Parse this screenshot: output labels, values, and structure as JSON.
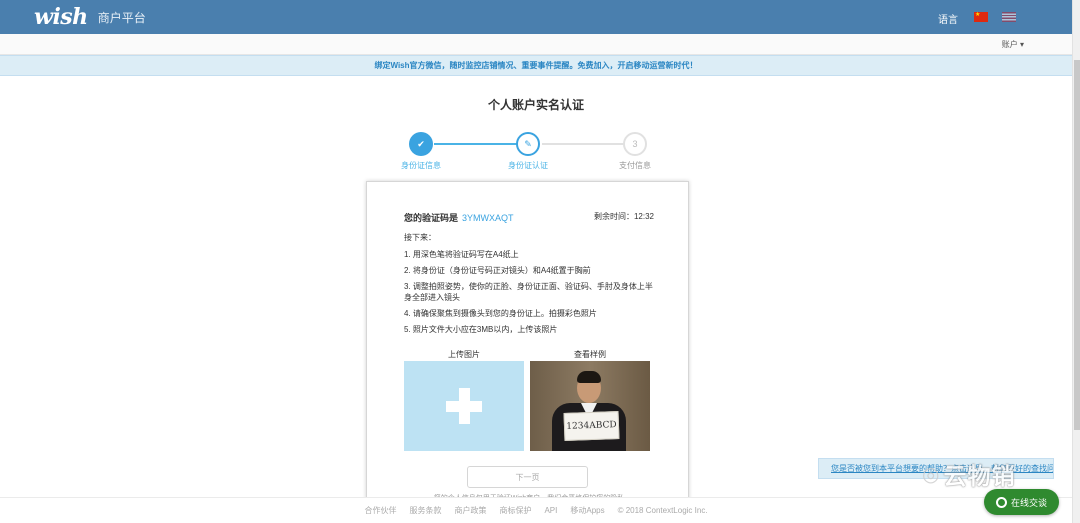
{
  "header": {
    "logo": "wish",
    "platform_title": "商户平台",
    "language_label": "语言",
    "flags": [
      "flag-cn-icon",
      "flag-us-icon"
    ],
    "brand_color": "#4a7fae"
  },
  "subbar": {
    "account_label": "账户 ▾"
  },
  "banner": {
    "text": "绑定Wish官方微信，随时监控店铺情况、重要事件提醒。免费加入，开启移动运营新时代！"
  },
  "page": {
    "title": "个人账户实名认证"
  },
  "steps": [
    {
      "icon": "✔",
      "label": "身份证信息",
      "state": "done"
    },
    {
      "icon": "✎",
      "label": "身份证认证",
      "state": "active"
    },
    {
      "icon": "3",
      "label": "支付信息",
      "state": "pending"
    }
  ],
  "verification": {
    "code_label": "您的验证码是",
    "code": "3YMWXAQT",
    "time_label": "剩余时间：",
    "time_value": "12:32",
    "next_steps_label": "接下来：",
    "instructions": [
      "1. 用深色笔将验证码写在A4纸上",
      "2. 将身份证（身份证号码正对镜头）和A4纸置于胸前",
      "3. 调整拍照姿势，使你的正脸、身份证正面、验证码、手肘及身体上半身全部进入镜头",
      "4. 请确保聚焦到摄像头到您的身份证上。拍摄彩色照片",
      "5. 照片文件大小应在3MB以内，上传该照片"
    ],
    "upload_label": "上传图片",
    "sample_label": "查看样例",
    "sample_card_text": "1234ABCD",
    "next_button": "下一页",
    "privacy_note": "您的个人信息仅用于验证Wish商户，我们会严格保护您的隐私"
  },
  "footer": {
    "links": [
      "合作伙伴",
      "服务条款",
      "商户政策",
      "商标保护",
      "API",
      "移动Apps"
    ],
    "copyright": "© 2018 ContextLogic Inc."
  },
  "help_bar": {
    "text": "您是否被您到本平台想要的帮助？点击这里，帮您更好的查找问题"
  },
  "watermark": {
    "text": "云物销"
  },
  "chat": {
    "label": "在线交谈",
    "color": "#2f8a2f"
  }
}
